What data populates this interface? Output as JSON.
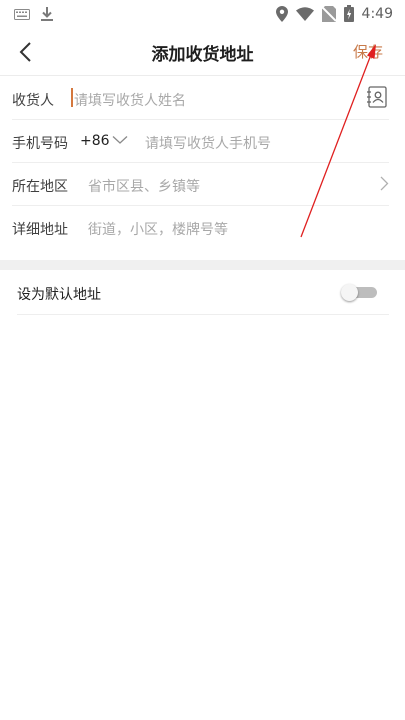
{
  "status_bar": {
    "time": "4:49",
    "icons": [
      "keyboard-icon",
      "download-icon",
      "location-icon",
      "wifi-icon",
      "no-sim-icon",
      "battery-icon"
    ]
  },
  "header": {
    "title": "添加收货地址",
    "save_label": "保存",
    "back_icon": "chevron-left-icon"
  },
  "form": {
    "recipient": {
      "label": "收货人",
      "placeholder": "请填写收货人姓名"
    },
    "phone": {
      "label": "手机号码",
      "prefix": "+86",
      "placeholder": "请填写收货人手机号"
    },
    "region": {
      "label": "所在地区",
      "placeholder": "省市区县、乡镇等"
    },
    "address": {
      "label": "详细地址",
      "placeholder": "街道，小区，楼牌号等"
    }
  },
  "default_setting": {
    "label": "设为默认地址",
    "enabled": false
  },
  "colors": {
    "accent": "#c87a4a",
    "annotation_arrow": "#e02020"
  }
}
